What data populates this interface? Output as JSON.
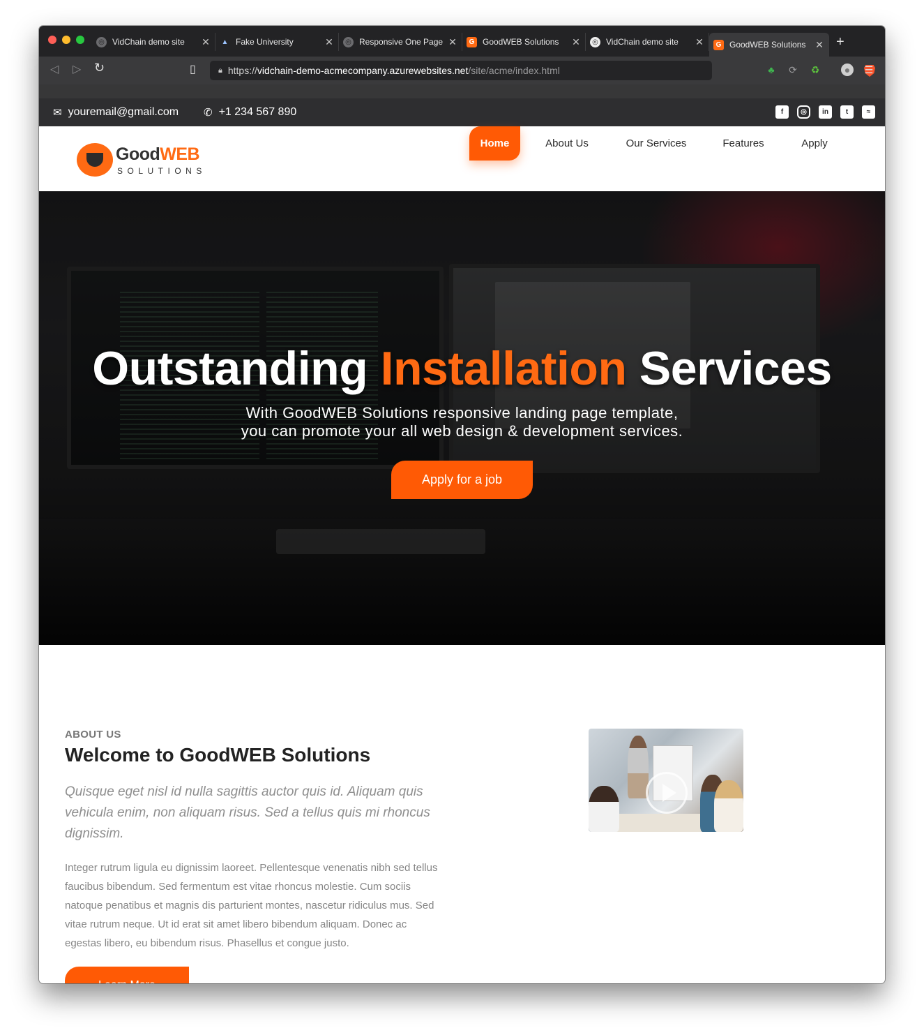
{
  "browser": {
    "tabs": [
      {
        "title": "VidChain demo site",
        "favicon": "globe-icon",
        "active": false
      },
      {
        "title": "Fake University",
        "favicon": "graduation-cap-icon",
        "active": false
      },
      {
        "title": "Responsive One Page",
        "favicon": "globe-icon",
        "active": false
      },
      {
        "title": "GoodWEB Solutions",
        "favicon": "goodweb-logo-icon",
        "active": false
      },
      {
        "title": "VidChain demo site",
        "favicon": "globe-icon",
        "active": false
      },
      {
        "title": "GoodWEB Solutions",
        "favicon": "goodweb-logo-icon",
        "active": true
      }
    ],
    "close_glyph": "✕",
    "new_tab_glyph": "+",
    "url": {
      "scheme": "https://",
      "host": "vidchain-demo-acmecompany.azurewebsites.net",
      "path": "/site/acme/index.html"
    }
  },
  "topbar": {
    "email": "youremail@gmail.com",
    "phone": "+1 234 567 890",
    "social_icons": [
      "facebook-icon",
      "instagram-icon",
      "linkedin-icon",
      "twitter-icon",
      "rss-icon"
    ]
  },
  "header": {
    "logo_good": "Good",
    "logo_web": "WEB",
    "logo_sub": "SOLUTIONS",
    "nav": [
      {
        "label": "Home",
        "active": true
      },
      {
        "label": "About Us",
        "active": false
      },
      {
        "label": "Our Services",
        "active": false
      },
      {
        "label": "Features",
        "active": false
      },
      {
        "label": "Apply",
        "active": false
      }
    ]
  },
  "hero": {
    "title_part1": "Outstanding",
    "title_accent": "Installation",
    "title_part2": "Services",
    "subtitle_line1": "With GoodWEB Solutions responsive landing page template,",
    "subtitle_line2": "you can promote your all web design & development services.",
    "button": "Apply for a job"
  },
  "about": {
    "eyebrow": "ABOUT US",
    "title": "Welcome to GoodWEB Solutions",
    "lead": "Quisque eget nisl id nulla sagittis auctor quis id. Aliquam quis vehicula enim, non aliquam risus. Sed a tellus quis mi rhoncus dignissim.",
    "body": "Integer rutrum ligula eu dignissim laoreet. Pellentesque venenatis nibh sed tellus faucibus bibendum. Sed fermentum est vitae rhoncus molestie. Cum sociis natoque penatibus et magnis dis parturient montes, nascetur ridiculus mus. Sed vitae rutrum neque. Ut id erat sit amet libero bibendum aliquam. Donec ac egestas libero, eu bibendum risus. Phasellus et congue justo.",
    "button": "Learn More"
  },
  "colors": {
    "accent": "#ff5a05",
    "chrome_dark": "#232325",
    "topbar": "#2e2e30"
  }
}
